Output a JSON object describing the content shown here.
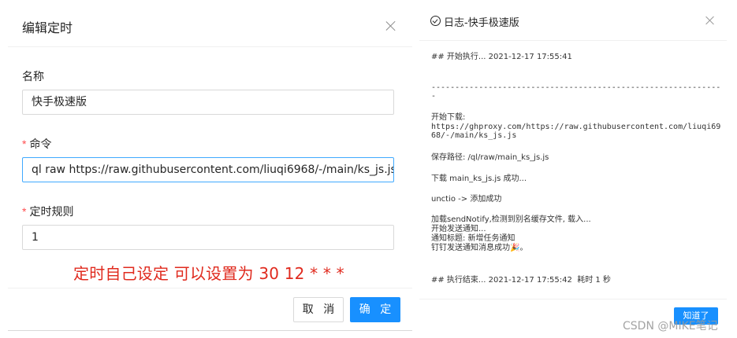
{
  "edit_dialog": {
    "title": "编辑定时",
    "fields": {
      "name": {
        "label": "名称",
        "value": "快手极速版"
      },
      "command": {
        "required_mark": "*",
        "label": "命令",
        "value": "ql raw https://raw.githubusercontent.com/liuqi6968/-/main/ks_js.js"
      },
      "schedule": {
        "required_mark": "*",
        "label": "定时规则",
        "value": "1"
      }
    },
    "annotation": "定时自己设定  可以设置为 30 12 * * *",
    "buttons": {
      "cancel": "取 消",
      "ok": "确 定"
    }
  },
  "log_dialog": {
    "title": "日志-快手极速版",
    "lines": {
      "start": "## 开始执行... 2021-12-17 17:55:41",
      "divider_1": "-------------------------------------------------------------",
      "divider_2": "-",
      "download_start": "开始下载:",
      "url_1": "https://ghproxy.com/https://raw.githubusercontent.com/liuqi69",
      "url_2": "68/-/main/ks_js.js",
      "save_path": "保存路径: /ql/raw/main_ks_js.js",
      "download_ok": "下载 main_ks_js.js 成功...",
      "unctio": "unctio -> 添加成功",
      "load_notify": "加载sendNotify,检测到别名缓存文件, 载入...",
      "send_start": "开始发送通知...",
      "notify_title": "通知标题: 新增任务通知",
      "dingtalk": "钉钉发送通知消息成功🎉。",
      "end": "## 执行结束... 2021-12-17 17:55:42  耗时 1 秒"
    },
    "ok_button": "知道了"
  },
  "watermark": "CSDN @MIKE笔记",
  "colors": {
    "primary": "#1890ff",
    "required": "#ff4d4f",
    "annotation": "#e02a1e",
    "border": "#d9d9d9"
  }
}
